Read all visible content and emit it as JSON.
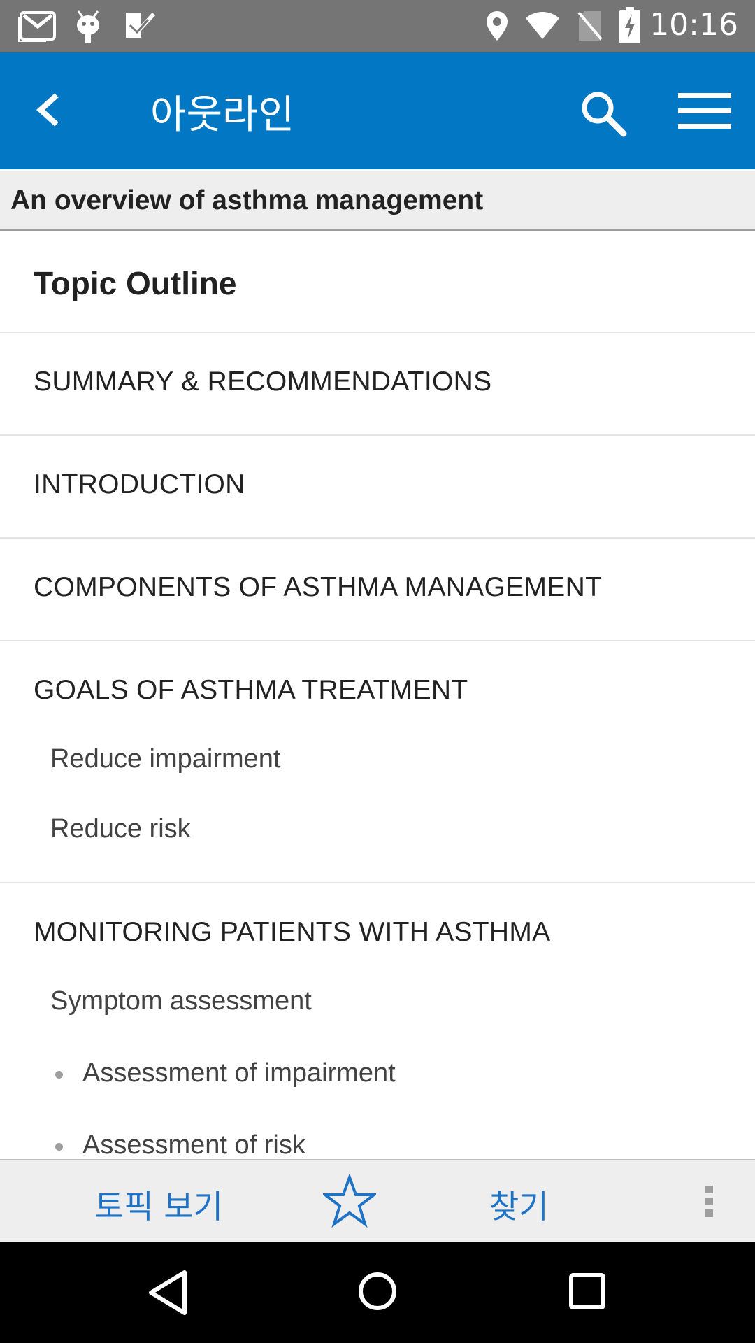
{
  "status_bar": {
    "time": "10:16",
    "icons": [
      "gmail-icon",
      "android-debug-icon",
      "task-check-icon",
      "location-icon",
      "wifi-icon",
      "no-sim-icon",
      "battery-charging-icon"
    ]
  },
  "app_bar": {
    "title": "아웃라인",
    "back_icon": "chevron-left-icon",
    "search_icon": "search-icon",
    "menu_icon": "hamburger-menu-icon"
  },
  "topic": {
    "title": "An overview of asthma management"
  },
  "outline": {
    "heading": "Topic Outline",
    "sections": [
      {
        "label": "SUMMARY & RECOMMENDATIONS"
      },
      {
        "label": "INTRODUCTION"
      },
      {
        "label": "COMPONENTS OF ASTHMA MANAGEMENT"
      },
      {
        "label": "GOALS OF ASTHMA TREATMENT",
        "subs": [
          "Reduce impairment",
          "Reduce risk"
        ]
      },
      {
        "label": "MONITORING PATIENTS WITH ASTHMA",
        "subs": [
          "Symptom assessment"
        ],
        "bullets": [
          "Assessment of impairment",
          "Assessment of risk"
        ]
      }
    ]
  },
  "bottom_bar": {
    "view_topic": "토픽 보기",
    "bookmark_icon": "star-outline-icon",
    "find": "찾기",
    "more_icon": "overflow-menu-icon"
  },
  "colors": {
    "app_bar": "#0277c4",
    "status_bar": "#757575",
    "accent_text": "#1f73c7"
  }
}
